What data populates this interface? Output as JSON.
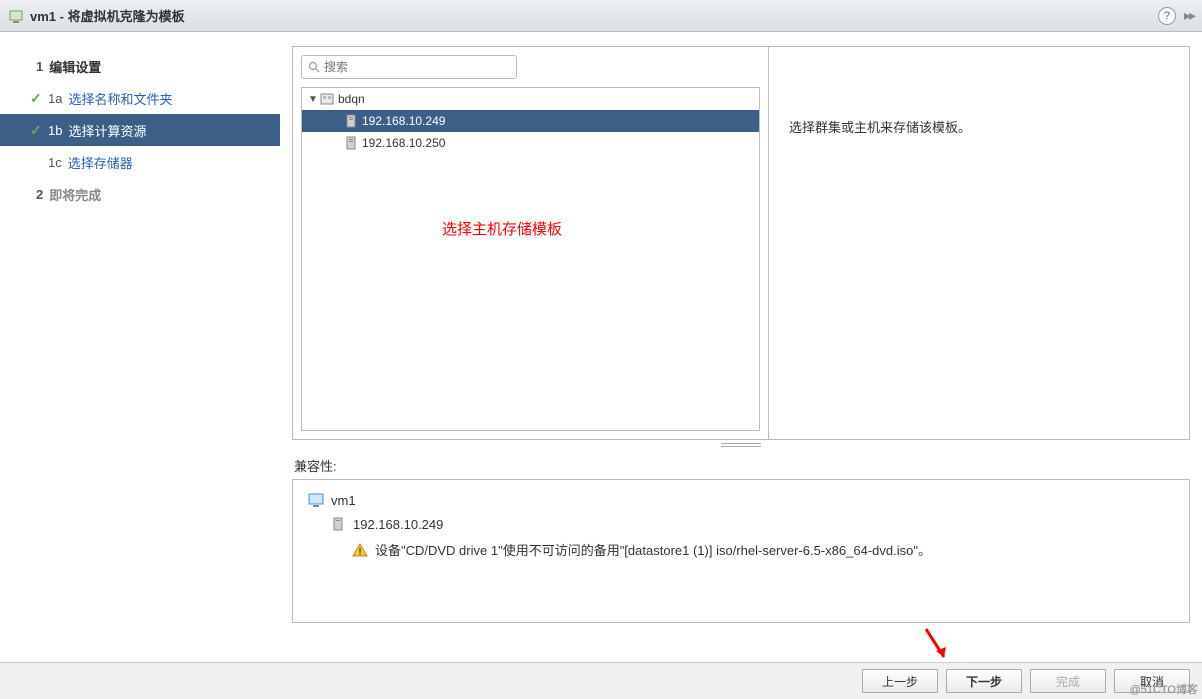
{
  "titlebar": {
    "title": "vm1 - 将虚拟机克隆为模板"
  },
  "wizard": {
    "step1": {
      "label": "编辑设置"
    },
    "step1a": {
      "num": "1a",
      "label": "选择名称和文件夹"
    },
    "step1b": {
      "num": "1b",
      "label": "选择计算资源"
    },
    "step1c": {
      "num": "1c",
      "label": "选择存储器"
    },
    "step2": {
      "num": "2",
      "label": "即将完成"
    }
  },
  "search": {
    "placeholder": "搜索"
  },
  "tree": {
    "root": "bdqn",
    "host1": "192.168.10.249",
    "host2": "192.168.10.250"
  },
  "annotation": "选择主机存储模板",
  "info_text": "选择群集或主机来存储该模板。",
  "compat": {
    "label": "兼容性:",
    "vm": "vm1",
    "host": "192.168.10.249",
    "warning": "设备\"CD/DVD drive 1\"使用不可访问的备用\"[datastore1 (1)] iso/rhel-server-6.5-x86_64-dvd.iso\"。"
  },
  "buttons": {
    "back": "上一步",
    "next": "下一步",
    "finish": "完成",
    "cancel": "取消"
  },
  "watermark": "@51CTO博客"
}
